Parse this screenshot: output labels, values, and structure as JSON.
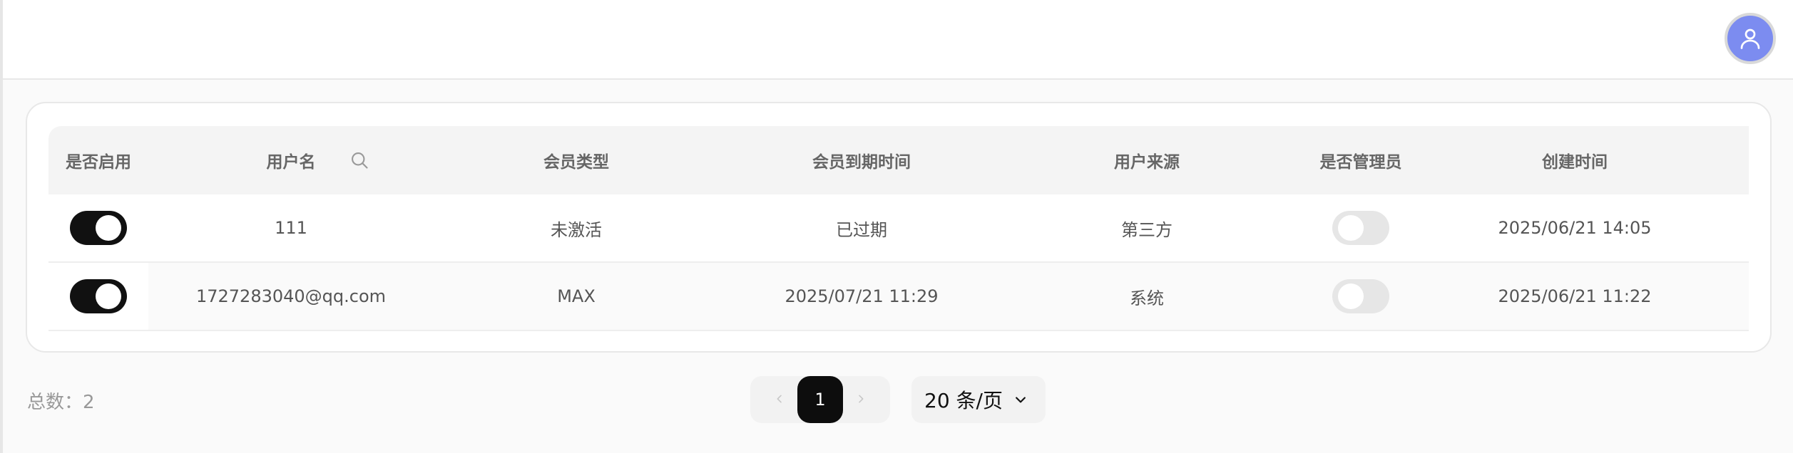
{
  "table": {
    "headers": {
      "enabled": "是否启用",
      "username": "用户名",
      "member_type": "会员类型",
      "member_expire": "会员到期时间",
      "source": "用户来源",
      "is_admin": "是否管理员",
      "created": "创建时间"
    },
    "rows": [
      {
        "enabled": true,
        "username": "111",
        "member_type": "未激活",
        "member_expire": "已过期",
        "source": "第三方",
        "is_admin": false,
        "created": "2025/06/21 14:05"
      },
      {
        "enabled": true,
        "username": "1727283040@qq.com",
        "member_type": "MAX",
        "member_expire": "2025/07/21 11:29",
        "source": "系统",
        "is_admin": false,
        "created": "2025/06/21 11:22"
      }
    ]
  },
  "footer": {
    "total_label": "总数：",
    "total_count": "2",
    "current_page": "1",
    "page_size": "20 条/页"
  },
  "icons": {
    "avatar": "user-icon",
    "search": "search-icon",
    "prev": "chevron-left-icon",
    "next": "chevron-right-icon",
    "dropdown": "chevron-down-icon"
  },
  "colors": {
    "avatar_bg": "#7c8cf0",
    "toggle_on": "#111111",
    "toggle_off": "#e6e6e6",
    "active_page": "#0d0d0d"
  }
}
